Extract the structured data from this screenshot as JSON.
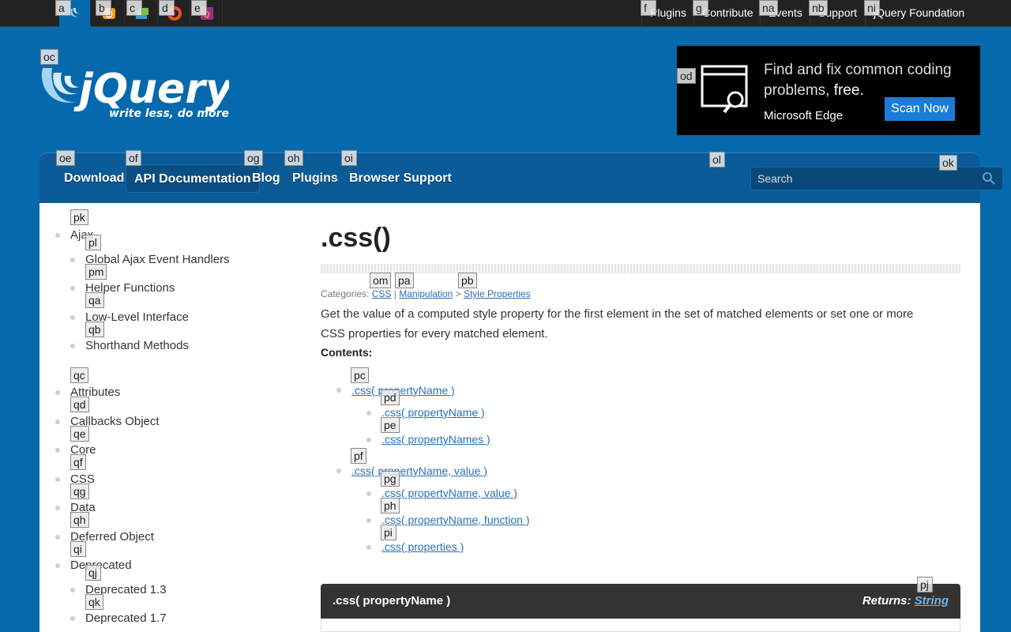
{
  "projects": [
    {
      "name": "jquery-icon",
      "tag": "a",
      "active": true
    },
    {
      "name": "jquery-ui-icon",
      "tag": "b"
    },
    {
      "name": "jquery-mobile-icon",
      "tag": "c"
    },
    {
      "name": "qunit-icon",
      "tag": "d"
    },
    {
      "name": "sizzle-icon",
      "tag": "e"
    }
  ],
  "top_links": [
    {
      "label": "Plugins",
      "tag": "f"
    },
    {
      "label": "Contribute",
      "tag": "g"
    },
    {
      "label": "Events",
      "tag": "na"
    },
    {
      "label": "Support",
      "tag": "nb"
    },
    {
      "label": "jQuery Foundation",
      "tag": "ni"
    }
  ],
  "logo": {
    "word": "jQuery",
    "tagline": "write less, do more.",
    "tag": "oc"
  },
  "ad": {
    "line1": "Find and fix common coding",
    "line2": "problems, ",
    "line2_bold": "free.",
    "brand": "Microsoft Edge",
    "button": "Scan Now",
    "tag": "od"
  },
  "nav": {
    "links": [
      {
        "label": "Download",
        "tag": "oe"
      },
      {
        "label": "API Documentation",
        "tag": "of"
      },
      {
        "label": "Blog",
        "tag": "og"
      },
      {
        "label": "Plugins",
        "tag": "oh"
      },
      {
        "label": "Browser Support",
        "tag": "oi"
      }
    ],
    "search_placeholder": "Search",
    "search_tag": "ol",
    "search_button_tag": "ok"
  },
  "sidebar": {
    "items": [
      {
        "label": "Ajax",
        "tag": "pk"
      },
      {
        "label": "Global Ajax Event Handlers",
        "tag": "pl"
      },
      {
        "label": "Helper Functions",
        "tag": "pm"
      },
      {
        "label": "Low-Level Interface",
        "tag": "qa"
      },
      {
        "label": "Shorthand Methods",
        "tag": "qb"
      },
      {
        "label": "Attributes",
        "tag": "qc"
      },
      {
        "label": "Callbacks Object",
        "tag": "qd"
      },
      {
        "label": "Core",
        "tag": "qe"
      },
      {
        "label": "CSS",
        "tag": "qf"
      },
      {
        "label": "Data",
        "tag": "qg"
      },
      {
        "label": "Deferred Object",
        "tag": "qh"
      },
      {
        "label": "Deprecated",
        "tag": "qi"
      },
      {
        "label": "Deprecated 1.3",
        "tag": "qj"
      },
      {
        "label": "Deprecated 1.7",
        "tag": "qk"
      }
    ]
  },
  "main": {
    "title": ".css()",
    "categories_label": "Categories:",
    "categories": [
      {
        "label": "CSS",
        "tag": "om"
      },
      {
        "label": "Manipulation",
        "tag": "pa"
      },
      {
        "label": "Style Properties",
        "tag": "pb"
      }
    ],
    "cat_sep1": "|",
    "cat_sep2": ">",
    "description": "Get the value of a computed style property for the first element in the set of matched elements or set one or more CSS properties for every matched element.",
    "contents_label": "Contents:",
    "toc": [
      {
        "label": ".css( propertyName )",
        "tag": "pc"
      },
      {
        "label": ".css( propertyName )",
        "tag": "pd"
      },
      {
        "label": ".css( propertyNames )",
        "tag": "pe"
      },
      {
        "label": ".css( propertyName, value )",
        "tag": "pf"
      },
      {
        "label": ".css( propertyName, value )",
        "tag": "pg"
      },
      {
        "label": ".css( propertyName, function )",
        "tag": "ph"
      },
      {
        "label": ".css( properties )",
        "tag": "pi"
      }
    ],
    "signature": {
      "name": ".css( propertyName )",
      "returns_label": "Returns: ",
      "returns_type": "String",
      "tag": "pj"
    }
  }
}
